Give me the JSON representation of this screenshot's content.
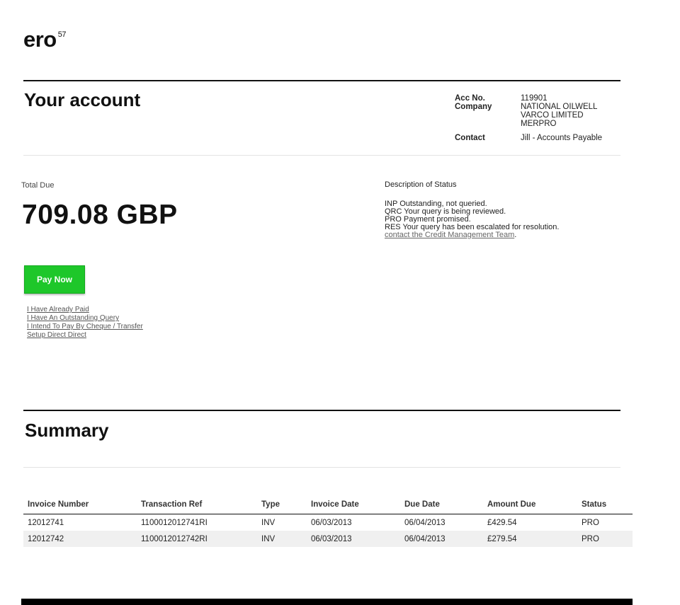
{
  "logo": {
    "text": "ero",
    "superscript": "57"
  },
  "account": {
    "title": "Your account",
    "acc_no_label": "Acc No.",
    "acc_no": "119901",
    "company_label": "Company",
    "company_lines": [
      "NATIONAL OILWELL",
      "VARCO LIMITED",
      "MERPRO"
    ],
    "contact_label": "Contact",
    "contact": "Jill - Accounts Payable"
  },
  "total": {
    "label": "Total Due",
    "amount": "709.08 GBP"
  },
  "pay_button": {
    "label": "Pay Now",
    "color": "#1ec72a"
  },
  "action_links": [
    "I Have Already Paid",
    "I Have An Outstanding Query",
    "I Intend To Pay By Cheque / Transfer",
    "Setup Direct Direct"
  ],
  "status_description": {
    "heading": "Description of Status",
    "lines": [
      "INP Outstanding, not queried.",
      "QRC Your query is being reviewed.",
      "PRO Payment promised.",
      "RES Your query has been escalated for resolution."
    ],
    "link": "contact the Credit Management Team",
    "link_suffix": "."
  },
  "summary": {
    "title": "Summary",
    "columns": [
      "Invoice Number",
      "Transaction Ref",
      "Type",
      "Invoice Date",
      "Due Date",
      "Amount Due",
      "Status"
    ],
    "rows": [
      [
        "12012741",
        "1100012012741RI",
        "INV",
        "06/03/2013",
        "06/04/2013",
        "£429.54",
        "PRO"
      ],
      [
        "12012742",
        "1100012012742RI",
        "INV",
        "06/03/2013",
        "06/04/2013",
        "£279.54",
        "PRO"
      ]
    ]
  }
}
